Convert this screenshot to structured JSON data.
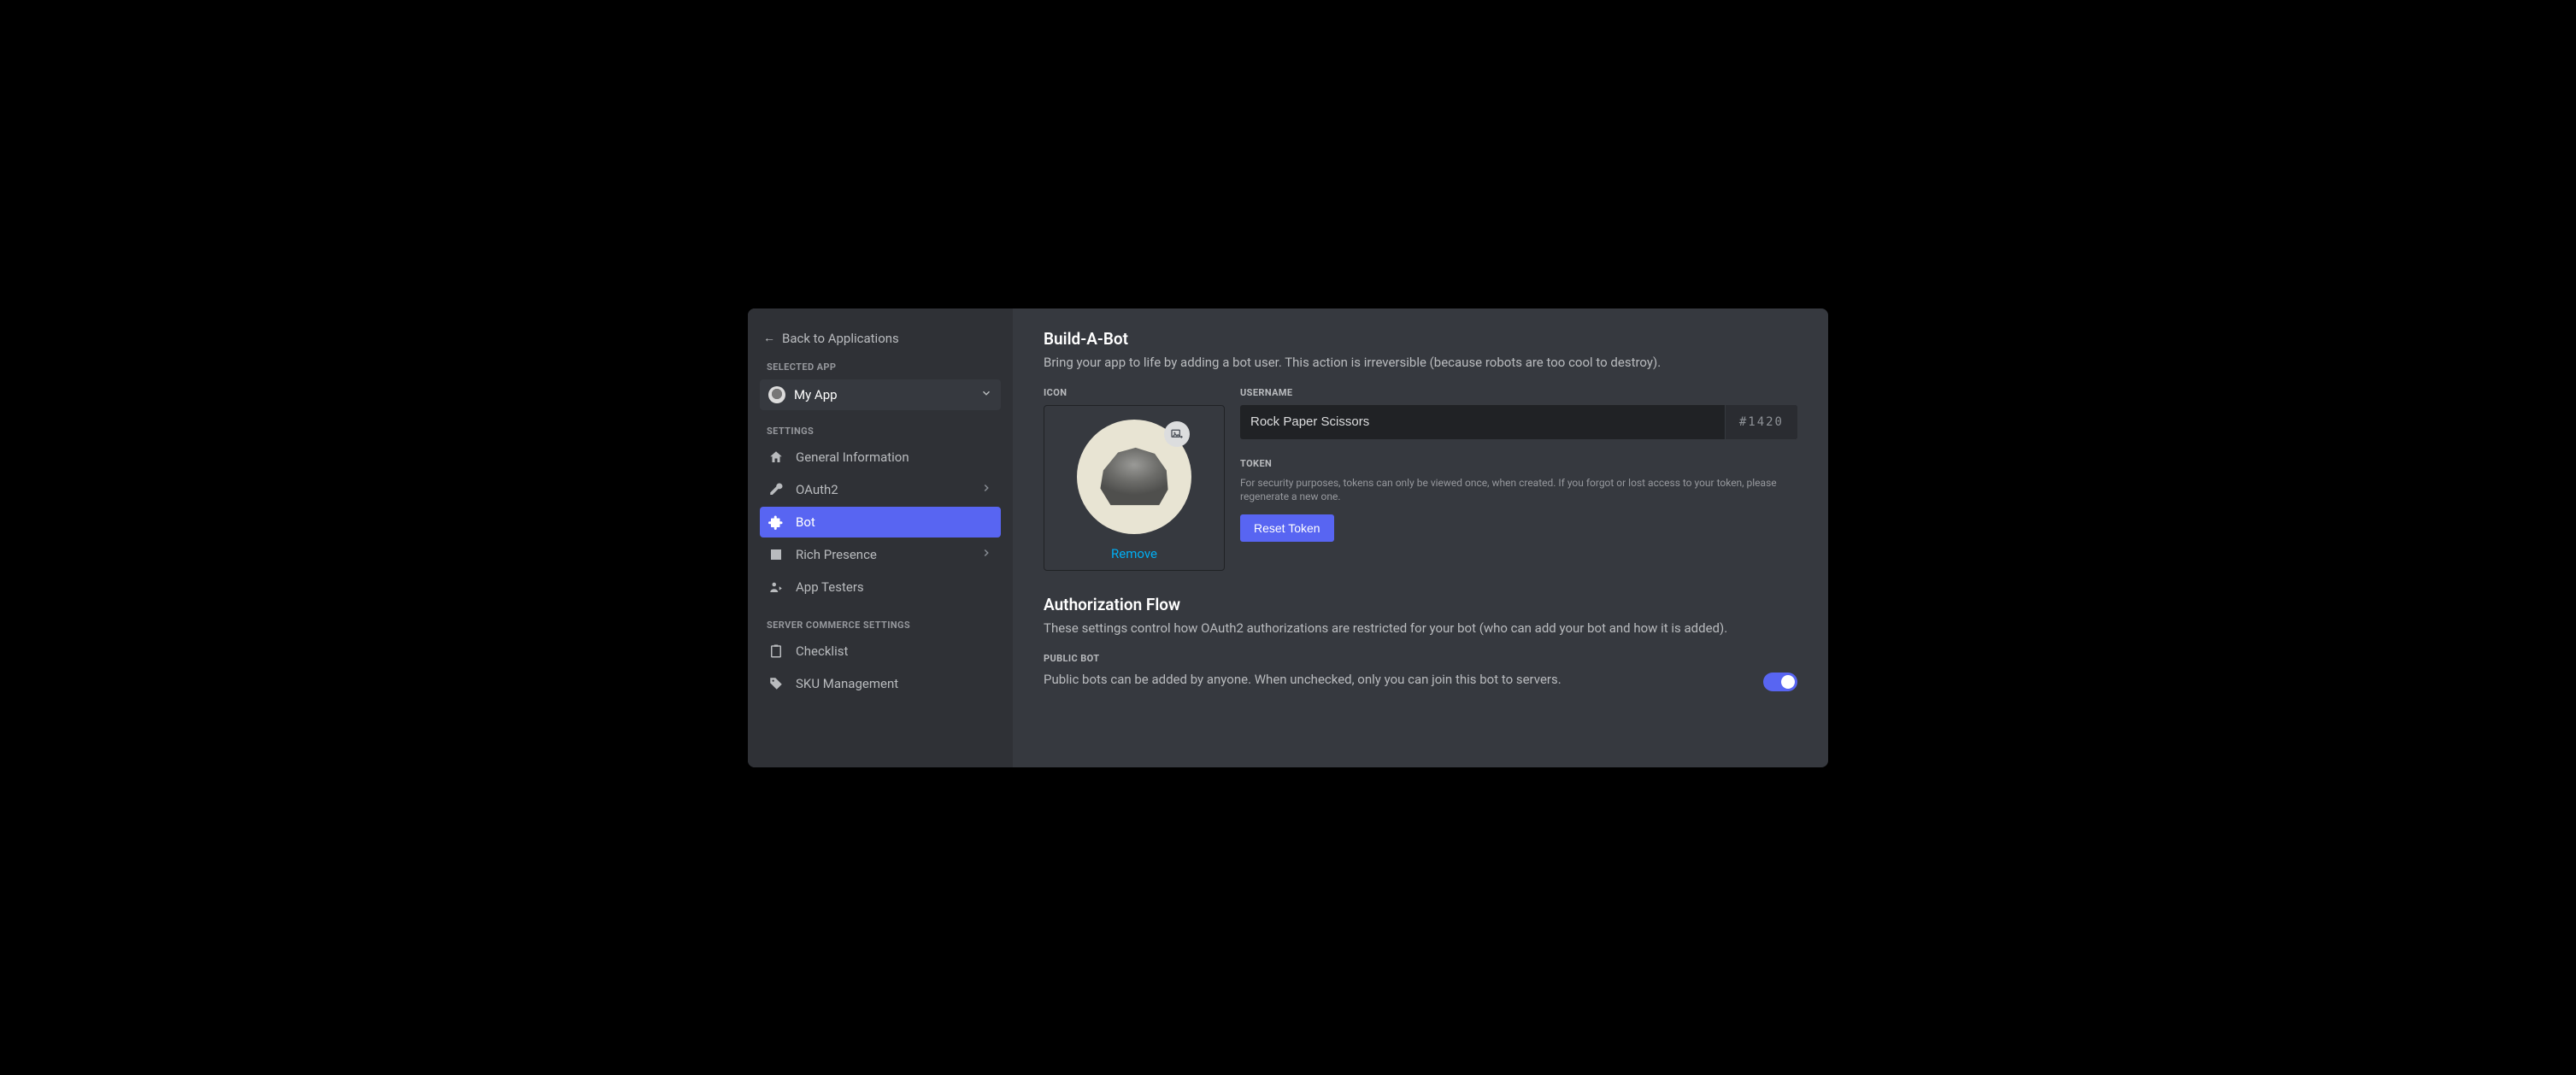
{
  "sidebar": {
    "back_label": "Back to Applications",
    "selected_app_heading": "Selected App",
    "app_name": "My App",
    "settings_heading": "Settings",
    "items": [
      {
        "label": "General Information",
        "has_chevron": false
      },
      {
        "label": "OAuth2",
        "has_chevron": true
      },
      {
        "label": "Bot",
        "has_chevron": false
      },
      {
        "label": "Rich Presence",
        "has_chevron": true
      },
      {
        "label": "App Testers",
        "has_chevron": false
      }
    ],
    "commerce_heading": "Server Commerce Settings",
    "commerce_items": [
      {
        "label": "Checklist"
      },
      {
        "label": "SKU Management"
      }
    ]
  },
  "main": {
    "build_title": "Build-A-Bot",
    "build_subtitle": "Bring your app to life by adding a bot user. This action is irreversible (because robots are too cool to destroy).",
    "icon_label": "Icon",
    "remove_label": "Remove",
    "username_label": "Username",
    "username_value": "Rock Paper Scissors",
    "discriminator": "#1420",
    "token_label": "Token",
    "token_help": "For security purposes, tokens can only be viewed once, when created. If you forgot or lost access to your token, please regenerate a new one.",
    "reset_token_label": "Reset Token",
    "auth_title": "Authorization Flow",
    "auth_subtitle": "These settings control how OAuth2 authorizations are restricted for your bot (who can add your bot and how it is added).",
    "public_bot_label": "Public Bot",
    "public_bot_desc": "Public bots can be added by anyone. When unchecked, only you can join this bot to servers.",
    "public_bot_on": true
  }
}
